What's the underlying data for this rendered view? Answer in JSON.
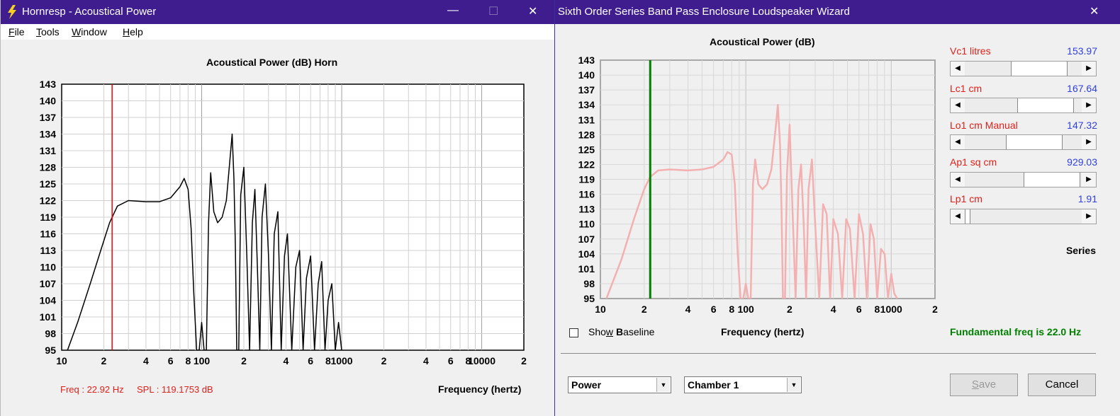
{
  "left": {
    "title": "Hornresp - Acoustical Power",
    "menu": [
      "File",
      "Tools",
      "Window",
      "Help"
    ],
    "chart_title": "Acoustical Power (dB)    Horn",
    "freq_readout": "Freq : 22.92 Hz",
    "spl_readout": "SPL : 119.1753 dB",
    "xlabel": "Frequency (hertz)"
  },
  "right": {
    "title": "Sixth Order Series Band Pass Enclosure Loudspeaker Wizard",
    "chart_title": "Acoustical Power (dB)",
    "xlabel": "Frequency (hertz)",
    "params": [
      {
        "label": "Vc1  litres",
        "value": "153.97",
        "pos": 0.76
      },
      {
        "label": "Lc1  cm",
        "value": "167.64",
        "pos": 0.87
      },
      {
        "label": "Lo1  cm  Manual",
        "value": "147.32",
        "pos": 0.68
      },
      {
        "label": "Ap1  sq cm",
        "value": "929.03",
        "pos": 0.98
      },
      {
        "label": "Lp1  cm",
        "value": "1.91",
        "pos": 0.0
      }
    ],
    "series_label": "Series",
    "show_baseline": "Show Baseline",
    "fundamental": "Fundamental freq is 22.0 Hz",
    "combo1": "Power",
    "combo2": "Chamber 1",
    "save": "Save",
    "cancel": "Cancel"
  },
  "colors": {
    "titlebar": "#3f1d8f",
    "marker_left": "#ff0000",
    "marker_right": "#008000",
    "curve_right": "#f4b0b0",
    "param_label": "#e0201a",
    "param_value": "#3040e0",
    "fundamental": "#008000"
  },
  "chart_data": [
    {
      "type": "line",
      "title": "Acoustical Power (dB)    Horn",
      "xlabel": "Frequency (hertz)",
      "ylabel": "",
      "xscale": "log",
      "xlim": [
        10,
        20000
      ],
      "ylim": [
        95,
        143
      ],
      "yticks": [
        95,
        98,
        101,
        104,
        107,
        110,
        113,
        116,
        119,
        122,
        125,
        128,
        131,
        134,
        137,
        140,
        143
      ],
      "xtick_labels": [
        "10",
        "2",
        "4",
        "6",
        "8",
        "100",
        "2",
        "4",
        "6",
        "8",
        "1000",
        "2",
        "4",
        "6",
        "8",
        "10000",
        "2"
      ],
      "marker_x": 22.92,
      "series": [
        {
          "x": [
            11,
            13,
            16,
            19,
            22,
            25,
            30,
            40,
            50,
            60,
            70,
            75,
            80,
            84,
            88,
            92,
            96,
            100,
            104,
            108,
            112,
            116,
            122,
            130,
            140,
            150,
            160,
            165,
            170,
            174,
            178,
            184,
            190,
            200,
            210,
            220,
            230,
            240,
            250,
            260,
            270,
            285,
            300,
            315,
            330,
            350,
            370,
            390,
            410,
            440,
            470,
            500,
            530,
            560,
            600,
            640,
            680,
            720,
            760,
            800,
            850,
            900,
            950,
            1000
          ],
          "y": [
            95,
            100,
            107,
            113,
            118,
            121,
            122,
            121.8,
            121.8,
            122.5,
            124.5,
            126,
            124,
            117,
            105,
            95,
            95,
            100,
            95,
            95,
            118,
            127,
            120,
            118,
            119,
            122,
            130,
            134,
            126,
            114,
            95,
            95,
            123,
            128,
            112,
            95,
            118,
            124,
            110,
            95,
            119,
            125,
            112,
            95,
            116,
            120,
            95,
            112,
            116,
            95,
            110,
            113,
            95,
            108,
            112,
            95,
            107,
            111,
            95,
            104,
            107,
            95,
            100,
            95
          ]
        }
      ]
    },
    {
      "type": "line",
      "title": "Acoustical Power (dB)",
      "xlabel": "Frequency (hertz)",
      "ylabel": "",
      "xscale": "log",
      "xlim": [
        10,
        2000
      ],
      "ylim": [
        95,
        143
      ],
      "yticks": [
        95,
        98,
        101,
        104,
        107,
        110,
        113,
        116,
        119,
        122,
        125,
        128,
        131,
        134,
        137,
        140,
        143
      ],
      "xtick_labels": [
        "10",
        "2",
        "4",
        "6",
        "8",
        "100",
        "2",
        "4",
        "6",
        "8",
        "1000",
        "2"
      ],
      "marker_x": 22.0,
      "series": [
        {
          "x": [
            11,
            14,
            17,
            20,
            22,
            25,
            30,
            40,
            50,
            60,
            70,
            75,
            80,
            84,
            88,
            92,
            96,
            100,
            104,
            108,
            112,
            116,
            122,
            130,
            140,
            150,
            160,
            166,
            172,
            176,
            180,
            186,
            192,
            200,
            210,
            220,
            230,
            240,
            250,
            260,
            270,
            285,
            300,
            320,
            340,
            360,
            380,
            400,
            430,
            460,
            490,
            520,
            560,
            600,
            640,
            680,
            720,
            760,
            800,
            850,
            900,
            950,
            1000,
            1050,
            1100
          ],
          "y": [
            95,
            103,
            111,
            117,
            119.5,
            120.8,
            121,
            120.8,
            121,
            121.5,
            123,
            124.5,
            124,
            118,
            104,
            95,
            95,
            98,
            95,
            95,
            118,
            123,
            118,
            117,
            118,
            121,
            129,
            134,
            126,
            113,
            95,
            95,
            120,
            130,
            112,
            95,
            117,
            122,
            110,
            95,
            117,
            123,
            110,
            95,
            114,
            112,
            95,
            111,
            108,
            95,
            111,
            109,
            95,
            112,
            108,
            95,
            110,
            107,
            95,
            105,
            104,
            95,
            100,
            96,
            95
          ]
        }
      ]
    }
  ]
}
